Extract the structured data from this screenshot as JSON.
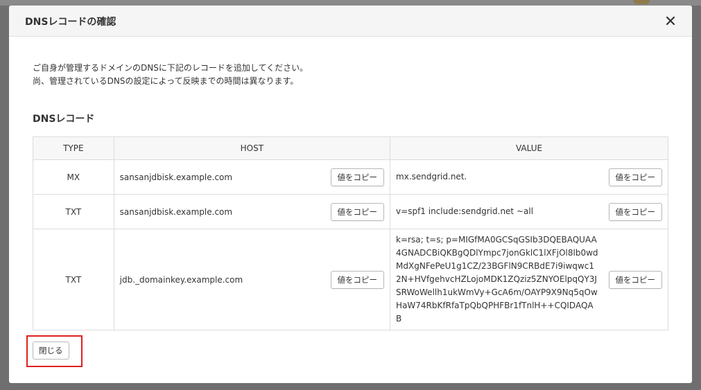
{
  "modal": {
    "title": "DNSレコードの確認",
    "close_icon": "close-icon"
  },
  "intro": {
    "line1": "ご自身が管理するドメインのDNSに下記のレコードを追加してください。",
    "line2": "尚、管理されているDNSの設定によって反映までの時間は異なります。"
  },
  "section_title": "DNSレコード",
  "table": {
    "headers": {
      "type": "TYPE",
      "host": "HOST",
      "value": "VALUE"
    },
    "copy_label": "値をコピー",
    "rows": [
      {
        "type": "MX",
        "host": "sansanjdbisk.example.com",
        "value": "mx.sendgrid.net."
      },
      {
        "type": "TXT",
        "host": "sansanjdbisk.example.com",
        "value": "v=spf1 include:sendgrid.net ~all"
      },
      {
        "type": "TXT",
        "host": "jdb._domainkey.example.com",
        "value": "k=rsa; t=s; p=MIGfMA0GCSqGSIb3DQEBAQUAA4GNADCBiQKBgQDlYmpc7jonGklC1lXFjOl8lb0wdMdXgNFePeU1g1CZ/23BGFlN9CRBdE7i9iwqwc12N+HVfgehvcHZLojoMDK1ZQziz5ZNYOElpqQY3JSRWoWellh1ukWmVy+GcA6m/OAYP9X9Nq5qOwHaW74RbKfRfaTpQbQPHFBr1fTnlH++CQIDAQAB"
      }
    ]
  },
  "footer": {
    "close_label": "閉じる"
  },
  "colors": {
    "highlight": "#e02020",
    "header_bg": "#f5f5f5",
    "table_header_bg": "#f7f7f7"
  }
}
